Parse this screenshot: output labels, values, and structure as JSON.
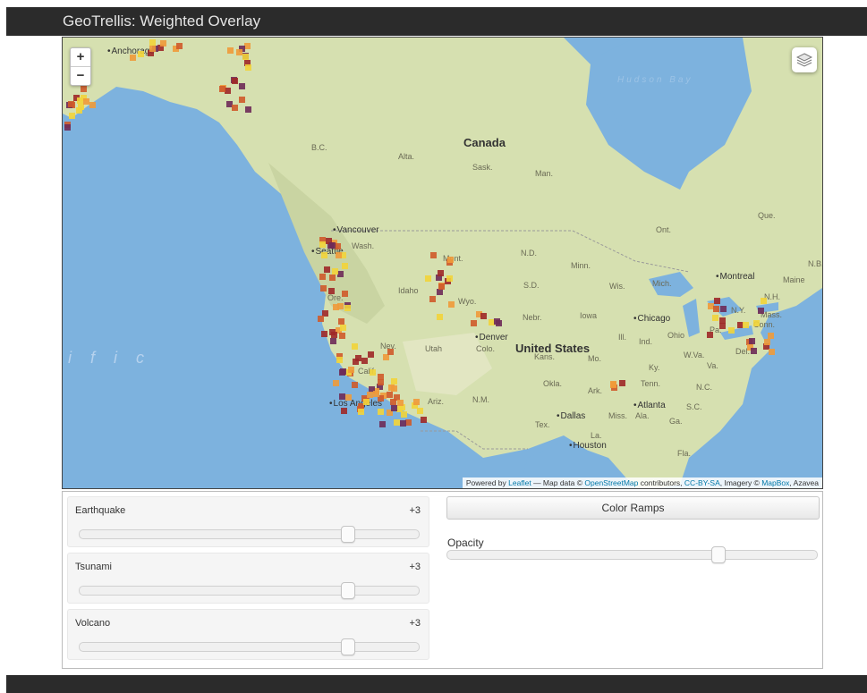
{
  "header": {
    "title": "GeoTrellis: Weighted Overlay"
  },
  "map": {
    "zoom_in": "+",
    "zoom_out": "−",
    "labels": {
      "hudson_bay": "Hudson Bay",
      "canada": "Canada",
      "united_states": "United States",
      "pacific": "i f i c",
      "bc": "B.C.",
      "alta": "Alta.",
      "sask": "Sask.",
      "man": "Man.",
      "ont": "Ont.",
      "que": "Que.",
      "nb": "N.B.",
      "maine": "Maine",
      "wash": "Wash.",
      "ore": "Ore.",
      "idaho": "Idaho",
      "mont": "Mont.",
      "wyo": "Wyo.",
      "nev": "Nev.",
      "utah": "Utah",
      "calif": "Calif.",
      "ariz": "Ariz.",
      "nm": "N.M.",
      "colo": "Colo.",
      "nd": "N.D.",
      "sd": "S.D.",
      "nebr": "Nebr.",
      "kans": "Kans.",
      "okla": "Okla.",
      "tex": "Tex.",
      "minn": "Minn.",
      "iowa": "Iowa",
      "mo": "Mo.",
      "ark": "Ark.",
      "la": "La.",
      "wis": "Wis.",
      "ill": "Ill.",
      "ind": "Ind.",
      "mich": "Mich.",
      "ohio": "Ohio",
      "ky": "Ky.",
      "tenn": "Tenn.",
      "miss": "Miss.",
      "ala": "Ala.",
      "ga": "Ga.",
      "fla": "Fla.",
      "sc": "S.C.",
      "nc": "N.C.",
      "va": "Va.",
      "wva": "W.Va.",
      "pa": "Pa.",
      "ny": "N.Y.",
      "nh": "N.H.",
      "mass": "Mass.",
      "conn": "Conn.",
      "del": "Del.",
      "anchorage": "Anchorage",
      "vancouver": "Vancouver",
      "seattle": "Seattle",
      "denver": "Denver",
      "chicago": "Chicago",
      "montreal": "Montreal",
      "los_angeles": "Los Angeles",
      "dallas": "Dallas",
      "houston": "Houston",
      "atlanta": "Atlanta"
    },
    "attribution": {
      "powered_by": "Powered by",
      "leaflet": "Leaflet",
      "map_data": "— Map data ©",
      "osm": "OpenStreetMap",
      "contributors": "contributors,",
      "license": "CC-BY-SA",
      "imagery": ", Imagery ©",
      "mapbox": "MapBox",
      "azavea": ", Azavea"
    }
  },
  "factors": [
    {
      "name": "Earthquake",
      "weight_label": "+3",
      "weight": 3
    },
    {
      "name": "Tsunami",
      "weight_label": "+3",
      "weight": 3
    },
    {
      "name": "Volcano",
      "weight_label": "+3",
      "weight": 3
    }
  ],
  "weight_range": [
    -5,
    5
  ],
  "color_ramps_label": "Color Ramps",
  "opacity": {
    "label": "Opacity",
    "value": 0.74
  },
  "colors": {
    "ocean": "#7db2de",
    "land": "#d8e2b4",
    "overlay": [
      "#f2d43a",
      "#ef9a3a",
      "#cf5a2a",
      "#9e2828",
      "#6e2a58"
    ]
  }
}
